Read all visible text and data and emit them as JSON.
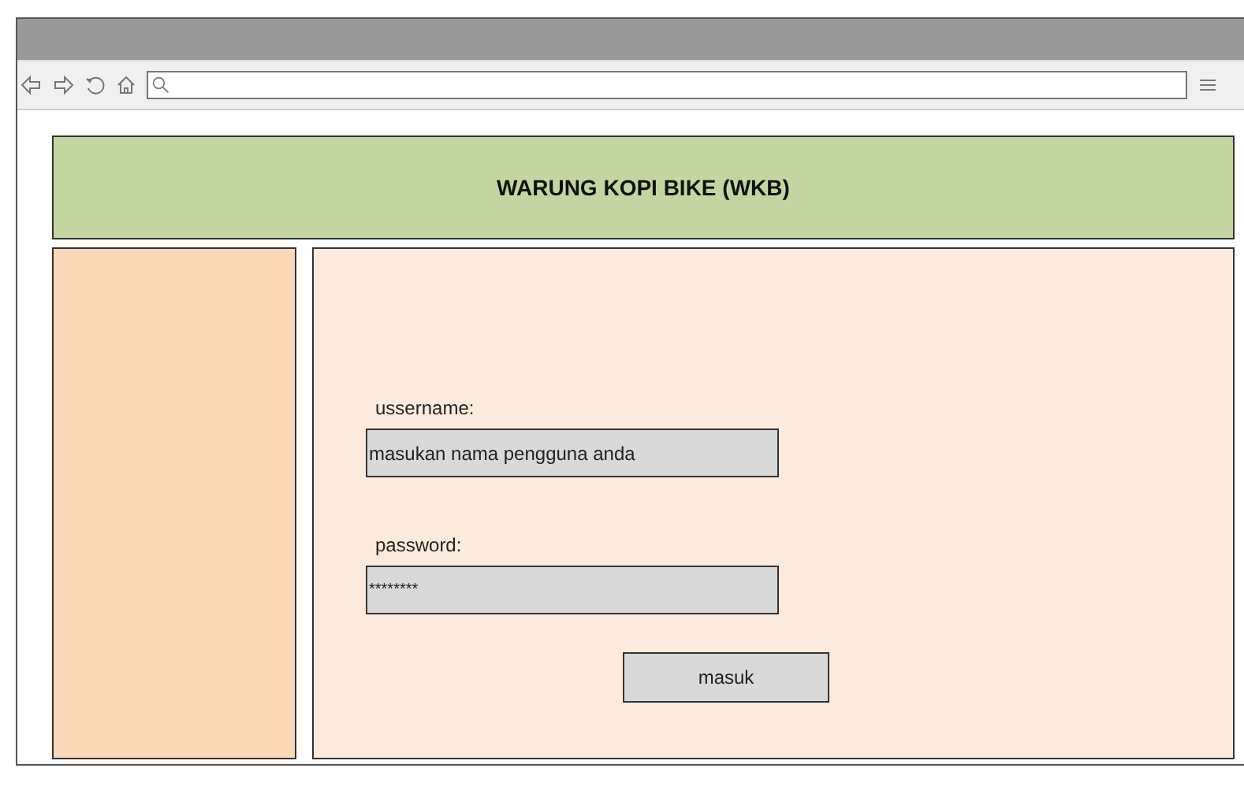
{
  "header": {
    "title": "WARUNG KOPI BIKE (WKB)"
  },
  "login": {
    "username": {
      "label": "ussername:",
      "placeholder": "masukan nama pengguna anda"
    },
    "password": {
      "label": "password:",
      "value": "********"
    },
    "button": "masuk"
  }
}
